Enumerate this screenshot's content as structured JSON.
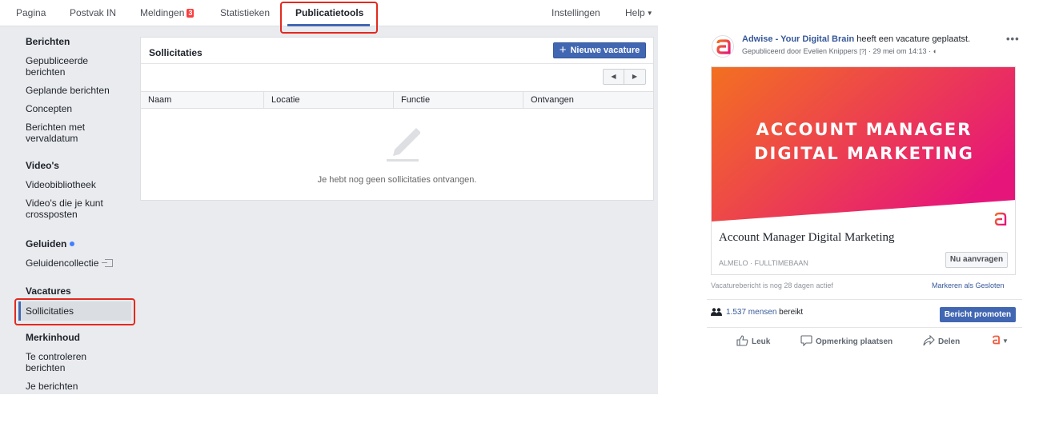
{
  "topnav": {
    "items": [
      {
        "label": "Pagina"
      },
      {
        "label": "Postvak IN"
      },
      {
        "label": "Meldingen",
        "badge": "3"
      },
      {
        "label": "Statistieken"
      },
      {
        "label": "Publicatietools",
        "active": true
      },
      {
        "label": "Instellingen"
      },
      {
        "label": "Help"
      }
    ],
    "accent_color": "#4267b2",
    "highlight_color": "#e3291f"
  },
  "sidebar": {
    "sections": [
      {
        "heading": "Berichten",
        "items": [
          "Gepubliceerde berichten",
          "Geplande berichten",
          "Concepten",
          "Berichten met vervaldatum"
        ]
      },
      {
        "heading": "Video's",
        "items": [
          "Videobibliotheek",
          "Video's die je kunt crossposten"
        ]
      },
      {
        "heading": "Geluiden",
        "items": [
          "Geluidencollectie"
        ]
      },
      {
        "heading": "Vacatures",
        "items": [
          "Sollicitaties"
        ],
        "selected": "Sollicitaties"
      },
      {
        "heading": "Merkinhoud",
        "items": [
          "Te controleren berichten",
          "Je berichten"
        ]
      }
    ]
  },
  "panel": {
    "title": "Sollicitaties",
    "new_button": "Nieuwe vacature",
    "columns": [
      "Naam",
      "Locatie",
      "Functie",
      "Ontvangen"
    ],
    "empty_text": "Je hebt nog geen sollicitaties ontvangen."
  },
  "post": {
    "author": "Adwise - Your Digital Brain",
    "action_text": "heeft een vacature geplaatst.",
    "published_by": "Gepubliceerd door Evelien Knippers",
    "published_q": "[?]",
    "date": "29 mei om 14:13",
    "banner_lines": [
      "ACCOUNT MANAGER",
      "DIGITAL MARKETING"
    ],
    "job_title": "Account Manager Digital Marketing",
    "job_meta": "ALMELO · FULLTIMEBAAN",
    "apply_button": "Nu aanvragen",
    "active_text": "Vacaturebericht is nog 28 dagen actief",
    "close_link": "Markeren als Gesloten",
    "reach_count": "1.537 mensen",
    "reach_suffix": "bereikt",
    "promote_button": "Bericht promoten",
    "actions": {
      "like": "Leuk",
      "comment": "Opmerking plaatsen",
      "share": "Delen"
    },
    "brand_orange": "#f37021",
    "brand_pink": "#e6157a"
  }
}
